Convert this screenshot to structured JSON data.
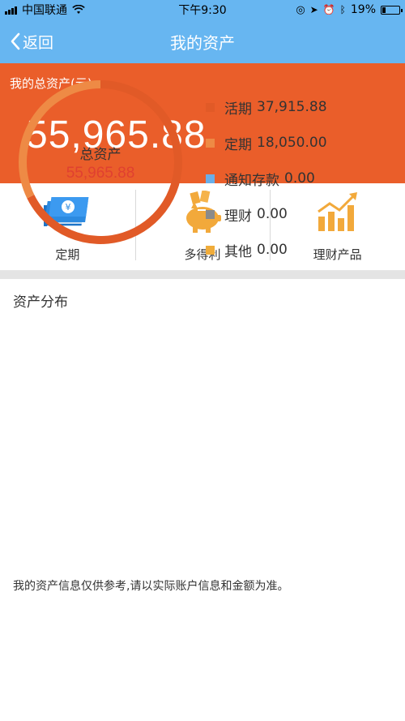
{
  "status_bar": {
    "carrier": "中国联通",
    "time": "下午9:30",
    "battery": "19%"
  },
  "navbar": {
    "back_label": "返回",
    "title": "我的资产"
  },
  "summary": {
    "label": "我的总资产(元)",
    "amount": "55,965.88"
  },
  "quick_actions": [
    {
      "label": "定期",
      "icon": "deposit-bill-icon"
    },
    {
      "label": "多得利",
      "icon": "piggy-bank-icon"
    },
    {
      "label": "理财产品",
      "icon": "bar-chart-icon"
    }
  ],
  "distribution": {
    "title": "资产分布",
    "center_label": "总资产",
    "center_value": "55,965.88",
    "items": [
      {
        "name": "活期",
        "value": "37,915.88",
        "color": "#e15a27"
      },
      {
        "name": "定期",
        "value": "18,050.00",
        "color": "#ee8a45"
      },
      {
        "name": "通知存款",
        "value": "0.00",
        "color": "#6aaee8"
      },
      {
        "name": "理财",
        "value": "0.00",
        "color": "#8a8a8a"
      },
      {
        "name": "其他",
        "value": "0.00",
        "color": "#f0ac3a"
      }
    ]
  },
  "note": "我的资产信息仅供参考,请以实际账户信息和金额为准。",
  "colors": {
    "header_blue": "#67b6f1",
    "summary_orange": "#ea5e2a"
  }
}
